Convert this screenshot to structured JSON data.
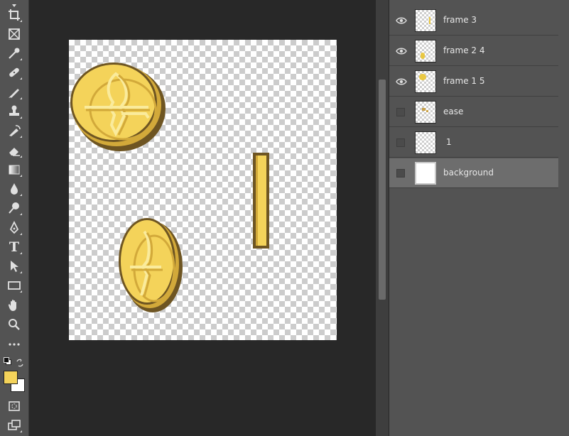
{
  "toolbar": {
    "tools": [
      {
        "name": "move-tool",
        "icon": "move-icon"
      },
      {
        "name": "crop-tool",
        "icon": "crop-icon"
      },
      {
        "name": "frame-tool",
        "icon": "frame-icon"
      },
      {
        "name": "eyedropper-tool",
        "icon": "eyedropper-icon"
      },
      {
        "name": "healing-brush-tool",
        "icon": "bandage-icon"
      },
      {
        "name": "brush-tool",
        "icon": "brush-icon"
      },
      {
        "name": "clone-stamp-tool",
        "icon": "stamp-icon"
      },
      {
        "name": "history-brush-tool",
        "icon": "history-brush-icon"
      },
      {
        "name": "eraser-tool",
        "icon": "eraser-icon"
      },
      {
        "name": "gradient-tool",
        "icon": "gradient-icon"
      },
      {
        "name": "blur-tool",
        "icon": "drop-icon"
      },
      {
        "name": "dodge-tool",
        "icon": "dodge-icon"
      },
      {
        "name": "pen-tool",
        "icon": "pen-icon"
      },
      {
        "name": "type-tool",
        "icon": "type-icon"
      },
      {
        "name": "path-selection-tool",
        "icon": "arrow-icon"
      },
      {
        "name": "rectangle-tool",
        "icon": "rectangle-icon"
      },
      {
        "name": "hand-tool",
        "icon": "hand-icon"
      },
      {
        "name": "zoom-tool",
        "icon": "zoom-icon"
      },
      {
        "name": "more-tools",
        "icon": "ellipsis-icon"
      }
    ],
    "type_tool_label": "T",
    "foreground_color": "#f4d35a",
    "background_color": "#ffffff"
  },
  "layers": [
    {
      "name": "frame 3",
      "visible": true,
      "thumb": "bar"
    },
    {
      "name": "frame 2 4",
      "visible": true,
      "thumb": "coin-narrow"
    },
    {
      "name": "frame 1 5",
      "visible": true,
      "thumb": "coin"
    },
    {
      "name": "ease",
      "visible": false,
      "thumb": "sketch"
    },
    {
      "name": "1",
      "visible": false,
      "thumb": "empty"
    },
    {
      "name": "background",
      "visible": false,
      "thumb": "white",
      "selected": true
    }
  ],
  "colors": {
    "coin_fill": "#f4d35a",
    "coin_shade": "#d2a93a",
    "coin_outline": "#6e5522",
    "coin_highlight": "#faeb9c"
  }
}
